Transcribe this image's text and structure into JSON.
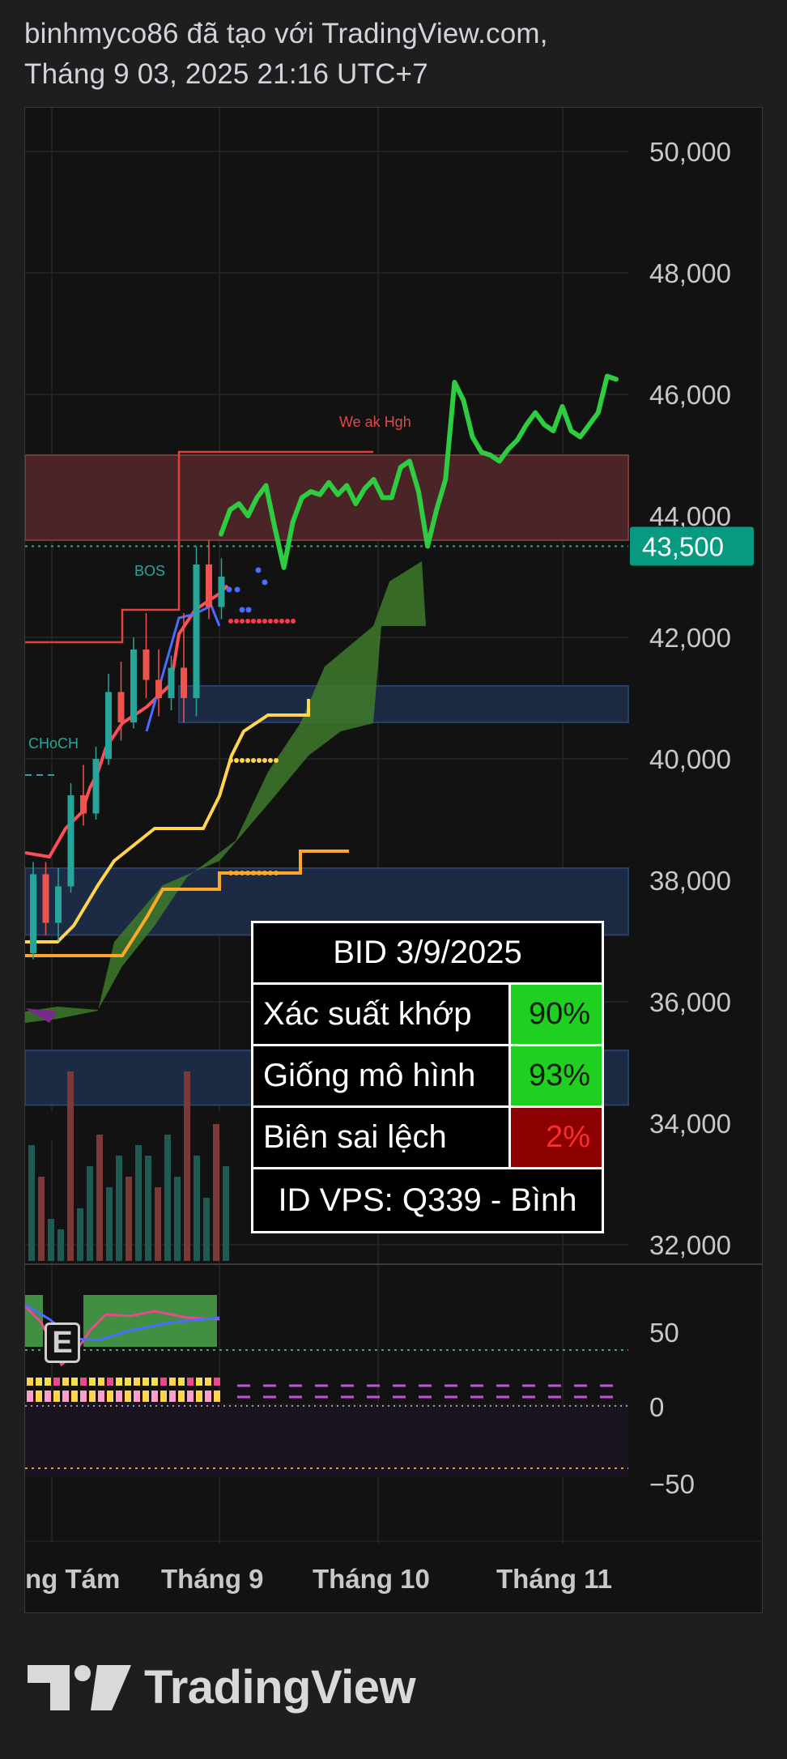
{
  "header": {
    "line1": "binhmyco86 đã tạo với TradingView.com,",
    "line2": "Tháng 9 03, 2025 21:16 UTC+7"
  },
  "chart_data": {
    "type": "line",
    "symbol": "BID",
    "price_axis": {
      "ticks": [
        "50,000",
        "48,000",
        "46,000",
        "44,000",
        "42,000",
        "40,000",
        "38,000",
        "36,000",
        "34,000",
        "32,000"
      ],
      "ylim": [
        32000,
        50500
      ],
      "current_price": 43500,
      "current_price_label": "43,500"
    },
    "time_axis": {
      "ticks": [
        "ng Tám",
        "Tháng 9",
        "Tháng 10",
        "Tháng 11"
      ]
    },
    "oscillator_axis": {
      "ticks": [
        "50",
        "0",
        "−50"
      ]
    },
    "annotations": [
      "We ak Hgh",
      "BOS",
      "CHoCH"
    ],
    "projection_series": {
      "name": "",
      "color": "#2ecc40",
      "values": [
        43700,
        44100,
        44200,
        44000,
        44300,
        44500,
        43800,
        43150,
        43900,
        44300,
        44400,
        44350,
        44550,
        44350,
        44500,
        44200,
        44450,
        44600,
        44300,
        44300,
        44800,
        44900,
        44400,
        43500,
        44100,
        44600,
        46200,
        45900,
        45300,
        45050,
        45000,
        44900,
        45100,
        45250,
        45500,
        45700,
        45500,
        45400,
        45800,
        45400,
        45300,
        45500,
        45700,
        46300,
        46250
      ]
    },
    "ohlc_candles": [
      [
        36800,
        38300,
        36700,
        38100
      ],
      [
        38100,
        38300,
        37100,
        37300
      ],
      [
        37300,
        38200,
        37000,
        37900
      ],
      [
        37900,
        39600,
        37800,
        39400
      ],
      [
        39400,
        39900,
        38900,
        39100
      ],
      [
        39100,
        40200,
        39000,
        40000
      ],
      [
        40000,
        41400,
        39900,
        41100
      ],
      [
        41100,
        41600,
        40300,
        40600
      ],
      [
        40600,
        42000,
        40500,
        41800
      ],
      [
        41800,
        42400,
        41000,
        41300
      ],
      [
        41300,
        41800,
        40700,
        41000
      ],
      [
        41000,
        41700,
        40800,
        41500
      ],
      [
        41500,
        42400,
        40600,
        41000
      ],
      [
        41000,
        43500,
        40700,
        43200
      ],
      [
        43200,
        43600,
        42300,
        42500
      ],
      [
        42500,
        43300,
        42300,
        43000
      ]
    ],
    "volume_bars": [
      0.55,
      0.4,
      0.2,
      0.15,
      0.9,
      0.25,
      0.45,
      0.6,
      0.35,
      0.5,
      0.4,
      0.55,
      0.5,
      0.35,
      0.6,
      0.4,
      0.9,
      0.5,
      0.3,
      0.65,
      0.45
    ],
    "info_table": {
      "title": "BID 3/9/2025",
      "rows": [
        {
          "label": "Xác suất khớp",
          "value": "90%",
          "color": "#20d020"
        },
        {
          "label": "Giống mô hình",
          "value": "93%",
          "color": "#20d020"
        },
        {
          "label": "Biên sai lệch",
          "value": "2%",
          "color": "#8b0000"
        }
      ],
      "footer": "ID VPS: Q339 - Bình"
    },
    "zones": {
      "weak_high_zone": [
        43600,
        45000
      ],
      "demand_zone_1": [
        40600,
        41200
      ],
      "demand_zone_2": [
        37100,
        38200
      ],
      "demand_zone_3": [
        34300,
        35200
      ]
    },
    "colors": {
      "bull": "#26a69a",
      "bear": "#ef5350",
      "projection": "#2ecc40",
      "price_label_bg": "#089981"
    }
  },
  "branding": {
    "logo_text": "TradingView",
    "badge": "E"
  }
}
